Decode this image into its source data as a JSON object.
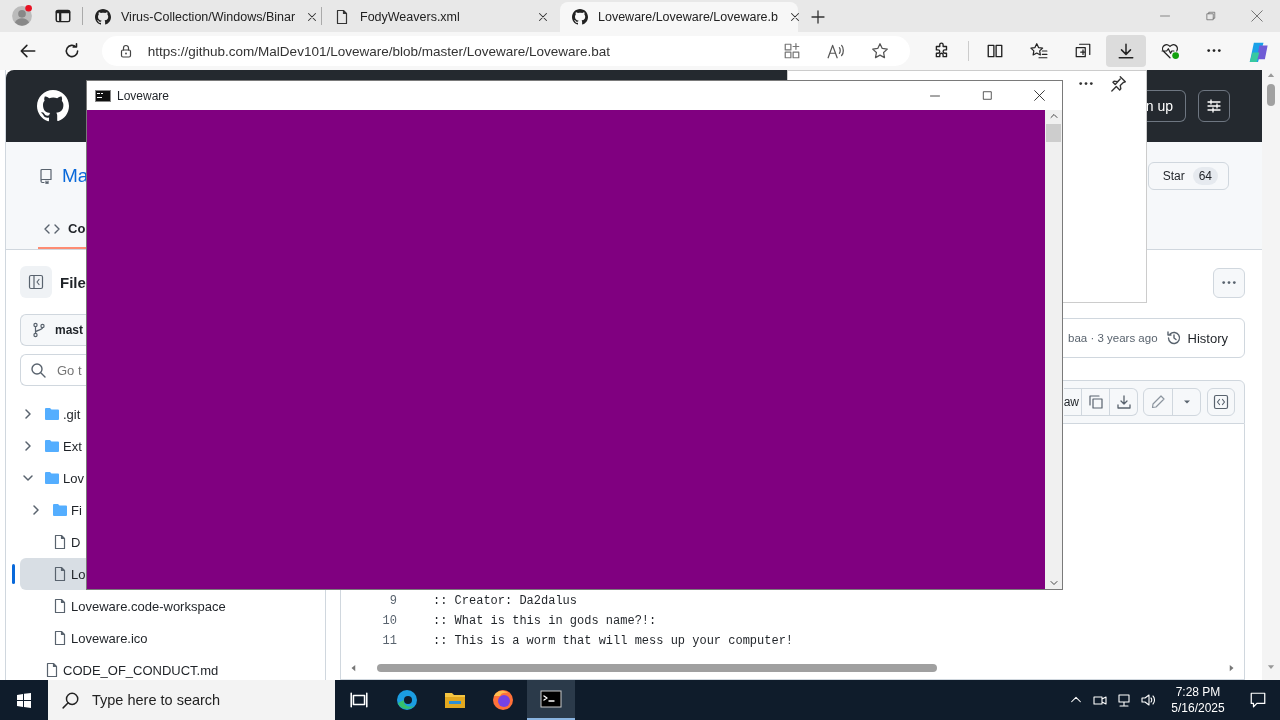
{
  "browser": {
    "tabs": [
      {
        "title": "Virus-Collection/Windows/Binar",
        "kind": "github",
        "selected": false
      },
      {
        "title": "FodyWeavers.xml",
        "kind": "file",
        "selected": false
      },
      {
        "title": "Loveware/Loveware/Loveware.b",
        "kind": "github",
        "selected": true
      }
    ],
    "address": "https://github.com/MalDev101/Loveware/blob/master/Loveware/Loveware.bat",
    "downloads_active": true
  },
  "page": {
    "signup": "n up",
    "repo_name": "Ma",
    "star": {
      "label": "Star",
      "count": "64"
    },
    "code_tab": "Co",
    "sidebar": {
      "title": "File",
      "branch": "mast",
      "search_placeholder": "Go t",
      "tree": [
        {
          "name": ".git",
          "kind": "folder",
          "expanded": false,
          "selected": false
        },
        {
          "name": "Ext",
          "kind": "folder",
          "expanded": false,
          "selected": false
        },
        {
          "name": "Lov",
          "kind": "folder",
          "expanded": true,
          "selected": false,
          "children": [
            {
              "name": "Fi",
              "kind": "folder",
              "expanded": false,
              "selected": false
            },
            {
              "name": "D",
              "kind": "file",
              "selected": false
            },
            {
              "name": "Lo",
              "kind": "file",
              "selected": true
            },
            {
              "name": "Loveware.code-workspace",
              "kind": "file",
              "selected": false
            },
            {
              "name": "Loveware.ico",
              "kind": "file",
              "selected": false
            }
          ]
        },
        {
          "name": "CODE_OF_CONDUCT.md",
          "kind": "file",
          "selected": false
        }
      ]
    },
    "commit": {
      "meta": "baa · 3 years ago",
      "history": "History"
    },
    "raw": "aw",
    "code_lines": [
      {
        "number": "9",
        "text": ":: Creator: Da2dalus"
      },
      {
        "number": "10",
        "text": ":: What is this in gods name?!:"
      },
      {
        "number": "11",
        "text": ":: This is a worm that will mess up your computer!"
      }
    ]
  },
  "console": {
    "title": "Loveware"
  },
  "taskbar": {
    "search_placeholder": "Type here to search",
    "apps": [
      {
        "kind": "taskview",
        "active": false
      },
      {
        "kind": "edge",
        "active": false
      },
      {
        "kind": "explorer",
        "active": false
      },
      {
        "kind": "firefox",
        "active": false
      },
      {
        "kind": "terminal",
        "active": true
      }
    ],
    "time": "7:28 PM",
    "date": "5/16/2025"
  }
}
